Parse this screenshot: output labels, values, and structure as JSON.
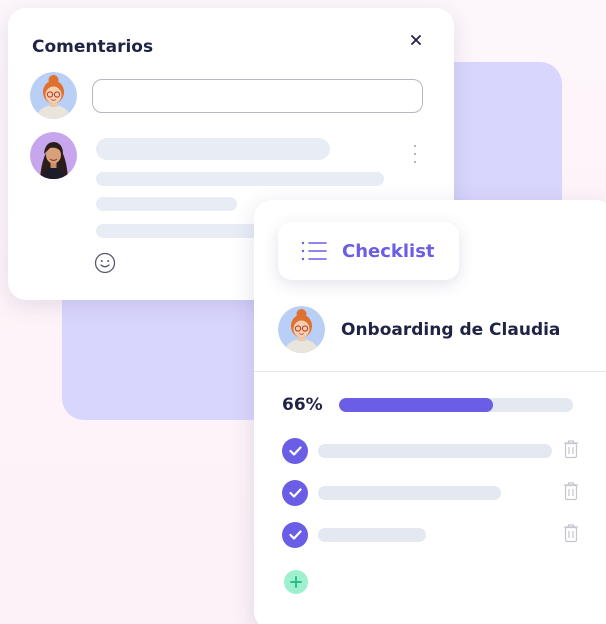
{
  "comments": {
    "title": "Comentarios",
    "input_value": "",
    "input_placeholder": ""
  },
  "checklist": {
    "label": "Checklist",
    "list_title": "Onboarding de Claudia",
    "progress_text": "66%",
    "progress_fraction": 0.66,
    "tasks": [
      {
        "done": true,
        "line_fraction": 1.0
      },
      {
        "done": true,
        "line_fraction": 0.78
      },
      {
        "done": true,
        "line_fraction": 0.46
      }
    ]
  },
  "colors": {
    "accent": "#6a5ee6",
    "back_panel": "#d9d6fd",
    "add_button": "#9ef0cf",
    "skeleton": "#e8edf5",
    "text_dark": "#1f2344"
  },
  "icons": {
    "close": "close-icon",
    "kebab": "kebab-menu-icon",
    "emoji": "smiley-icon",
    "list": "list-icon",
    "check": "check-icon",
    "trash": "trash-icon",
    "add": "plus-icon"
  }
}
